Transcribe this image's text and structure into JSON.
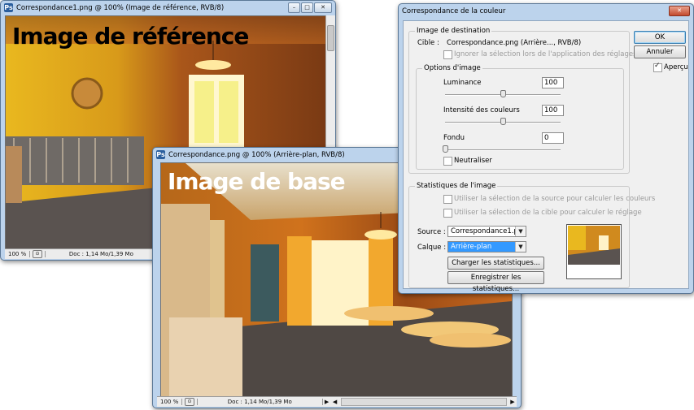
{
  "reference_window": {
    "title": "Correspondance1.png @ 100% (Image de référence, RVB/8)",
    "overlay_text": "Image de référence",
    "zoom": "100 %",
    "doc": "Doc : 1,14 Mo/1,39 Mo"
  },
  "base_window": {
    "title": "Correspondance.png @ 100% (Arrière-plan, RVB/8)",
    "overlay_text": "Image de base",
    "zoom": "100 %",
    "doc": "Doc : 1,14 Mo/1,39 Mo"
  },
  "dialog": {
    "title": "Correspondance de la couleur",
    "destination_group": "Image de destination",
    "cible_label": "Cible :",
    "cible_value": "Correspondance.png (Arrière..., RVB/8)",
    "ignore_selection": "Ignorer la sélection lors de l'application des réglages",
    "options_group": "Options d'image",
    "luminance_label": "Luminance",
    "luminance_value": "100",
    "luminance_level": 0.5,
    "intensity_label": "Intensité des couleurs",
    "intensity_value": "100",
    "intensity_level": 0.5,
    "fade_label": "Fondu",
    "fade_value": "0",
    "fade_level": 0,
    "neutralize_label": "Neutraliser",
    "stats_group": "Statistiques de l'image",
    "use_source_selection": "Utiliser la sélection de la source pour calculer les couleurs",
    "use_target_selection": "Utiliser la sélection de la cible pour calculer le réglage",
    "source_label": "Source :",
    "source_value": "Correspondance1.p...",
    "layer_label": "Calque :",
    "layer_value": "Arrière-plan",
    "load_stats_button": "Charger les statistiques...",
    "save_stats_button": "Enregistrer les statistiques...",
    "ok_button": "OK",
    "cancel_button": "Annuler",
    "preview_label": "Aperçu",
    "preview_checked": true
  },
  "colors": {
    "title_bar": "#bcd3ec",
    "dialog_bg": "#f0f0f0",
    "highlight": "#3399ff",
    "overlay_ref": "#000000",
    "overlay_base": "#ffffff"
  }
}
